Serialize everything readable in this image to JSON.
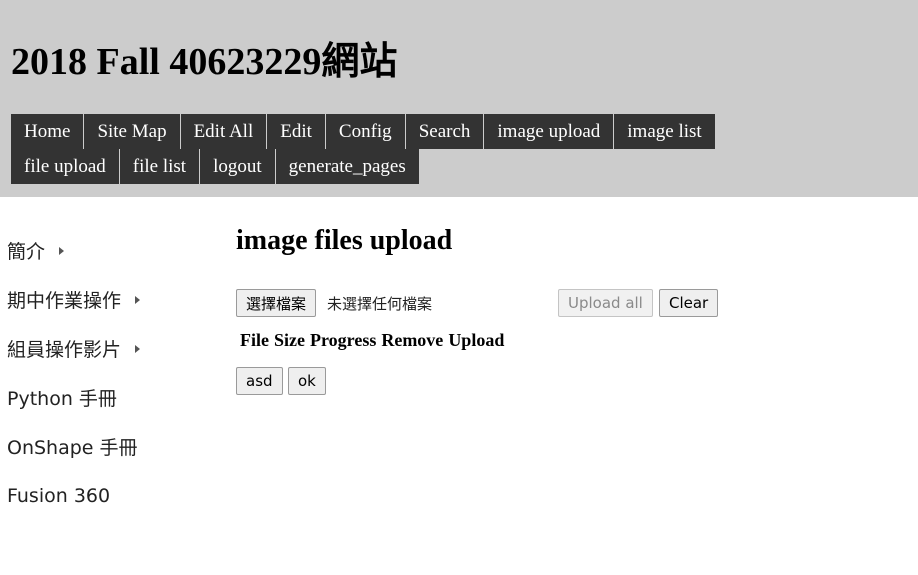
{
  "header": {
    "site_title": "2018 Fall 40623229網站"
  },
  "nav": {
    "row1": [
      "Home",
      "Site Map",
      "Edit All",
      "Edit",
      "Config",
      "Search",
      "image upload",
      "image list"
    ],
    "row2": [
      "file upload",
      "file list",
      "logout",
      "generate_pages"
    ]
  },
  "sidebar": {
    "items": [
      {
        "label": "簡介",
        "has_submenu": true
      },
      {
        "label": "期中作業操作",
        "has_submenu": true
      },
      {
        "label": "組員操作影片",
        "has_submenu": true
      },
      {
        "label": "Python 手冊",
        "has_submenu": false
      },
      {
        "label": "OnShape 手冊",
        "has_submenu": false
      },
      {
        "label": "Fusion 360",
        "has_submenu": false
      }
    ]
  },
  "main": {
    "title": "image files upload",
    "choose_file_label": "選擇檔案",
    "no_file_text": "未選擇任何檔案",
    "upload_all_label": "Upload all",
    "clear_label": "Clear",
    "table_headers": [
      "File",
      "Size",
      "Progress",
      "Remove",
      "Upload"
    ],
    "asd_label": "asd",
    "ok_label": "ok"
  },
  "colors": {
    "header_bg": "#cccccc",
    "nav_bg": "#333333",
    "nav_text": "#ffffff"
  }
}
